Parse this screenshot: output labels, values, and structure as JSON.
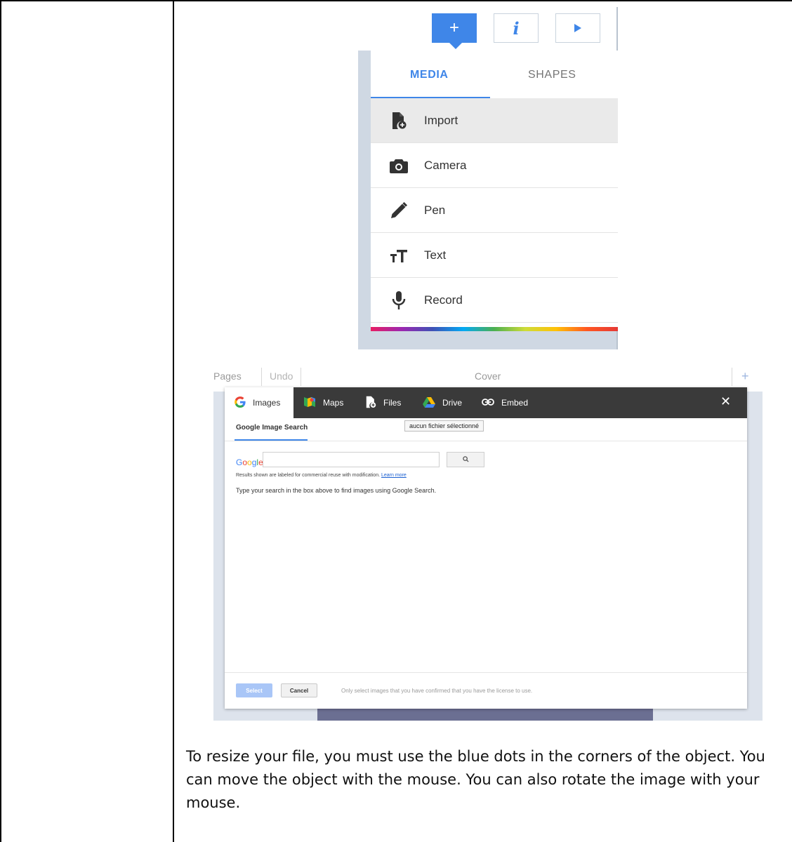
{
  "menu": {
    "toolbar": {
      "add_label": "+",
      "info_label": "i"
    },
    "tabs": [
      {
        "label": "MEDIA",
        "active": true
      },
      {
        "label": "SHAPES",
        "active": false
      }
    ],
    "items": [
      {
        "label": "Import",
        "icon": "file-import-icon",
        "highlighted": true
      },
      {
        "label": "Camera",
        "icon": "camera-icon",
        "highlighted": false
      },
      {
        "label": "Pen",
        "icon": "pen-icon",
        "highlighted": false
      },
      {
        "label": "Text",
        "icon": "text-size-icon",
        "highlighted": false
      },
      {
        "label": "Record",
        "icon": "microphone-icon",
        "highlighted": false
      }
    ],
    "accent_color": "#3f86e8"
  },
  "editor": {
    "topbar": {
      "pages_label": "Pages",
      "undo_label": "Undo",
      "title": "Cover",
      "add_label": "+"
    },
    "dialog": {
      "tabs": [
        {
          "label": "Images",
          "icon": "google-icon",
          "active": true
        },
        {
          "label": "Maps",
          "icon": "maps-icon",
          "active": false
        },
        {
          "label": "Files",
          "icon": "file-import-icon",
          "active": false
        },
        {
          "label": "Drive",
          "icon": "drive-icon",
          "active": false
        },
        {
          "label": "Embed",
          "icon": "link-icon",
          "active": false
        }
      ],
      "close_label": "✕",
      "tooltip": "aucun fichier sélectionné",
      "subtab": "Google Image Search",
      "google_logo": "Google",
      "search_value": "",
      "results_note": "Results shown are labeled for commercial reuse with modification.",
      "learn_more": "Learn more",
      "instruction": "Type your search in the box above to find images using Google Search.",
      "select_label": "Select",
      "cancel_label": "Cancel",
      "footer_note": "Only select images that you have confirmed that you have the license to use."
    }
  },
  "paragraph": "To resize your file, you must use the blue dots in the corners of the object. You can move the object with the mouse. You can also rotate the image with your mouse."
}
